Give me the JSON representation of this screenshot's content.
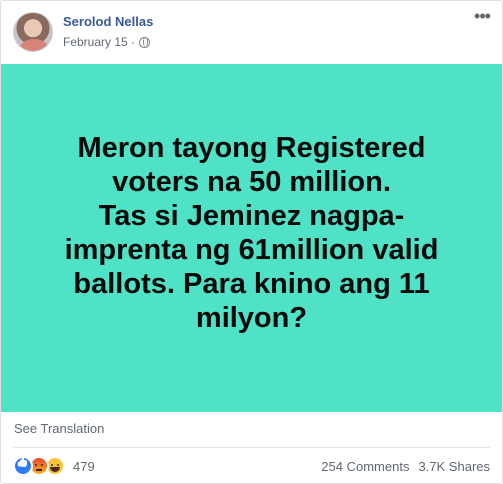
{
  "post": {
    "author": "Serolod Nellas",
    "date": "February 15",
    "separator": "·",
    "privacy_icon": "globe-icon",
    "more_icon": "more-options-icon",
    "card_text": "Meron tayong Registered\nvoters na 50 million.\nTas si Jeminez nagpa-\nimprenta ng 61million valid\nballots. Para knino ang 11\nmilyon?",
    "card_bg_color": "#4fe2c6",
    "see_translation": "See Translation",
    "reactions": {
      "icons": [
        "like-icon",
        "angry-icon",
        "haha-icon"
      ],
      "count": "479"
    },
    "comments": "254 Comments",
    "shares": "3.7K Shares"
  }
}
